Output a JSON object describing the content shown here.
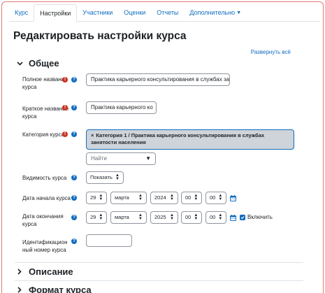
{
  "tabs": [
    {
      "label": "Курс"
    },
    {
      "label": "Настройки",
      "active": true
    },
    {
      "label": "Участники"
    },
    {
      "label": "Оценки"
    },
    {
      "label": "Отчеты"
    },
    {
      "label": "Дополнительно"
    }
  ],
  "page_title": "Редактировать настройки курса",
  "expand_all": "Развернуть всё",
  "sections": {
    "general": "Общее",
    "description": "Описание",
    "format": "Формат курса"
  },
  "fields": {
    "fullname": {
      "label": "Полное название курса",
      "value": "Практика карьерного консультирования в службах зан"
    },
    "shortname": {
      "label": "Краткое название курса",
      "value": "Практика карьерного ко"
    },
    "category": {
      "label": "Категория курса",
      "selected": "Категория 1 / Практика карьерного консультирования в службах занятости населения",
      "search_placeholder": "Найти"
    },
    "visibility": {
      "label": "Видимость курса",
      "value": "Показать"
    },
    "startdate": {
      "label": "Дата начала курса",
      "day": "29",
      "month": "марта",
      "year": "2024",
      "hour": "00",
      "minute": "00"
    },
    "enddate": {
      "label": "Дата окончания курса",
      "day": "29",
      "month": "марта",
      "year": "2025",
      "hour": "00",
      "minute": "00",
      "enable_label": "Включить",
      "enabled": true
    },
    "idnumber": {
      "label": "Идентификационный номер курса",
      "value": ""
    }
  },
  "icons": {
    "required": "exclamation-circle-icon",
    "help": "question-circle-icon",
    "calendar": "calendar-icon",
    "chevron_down": "chevron-down-icon",
    "chevron_right": "chevron-right-icon"
  },
  "colors": {
    "link": "#0f6cbf",
    "required": "#ca3120",
    "frame_border": "#e0796f"
  }
}
